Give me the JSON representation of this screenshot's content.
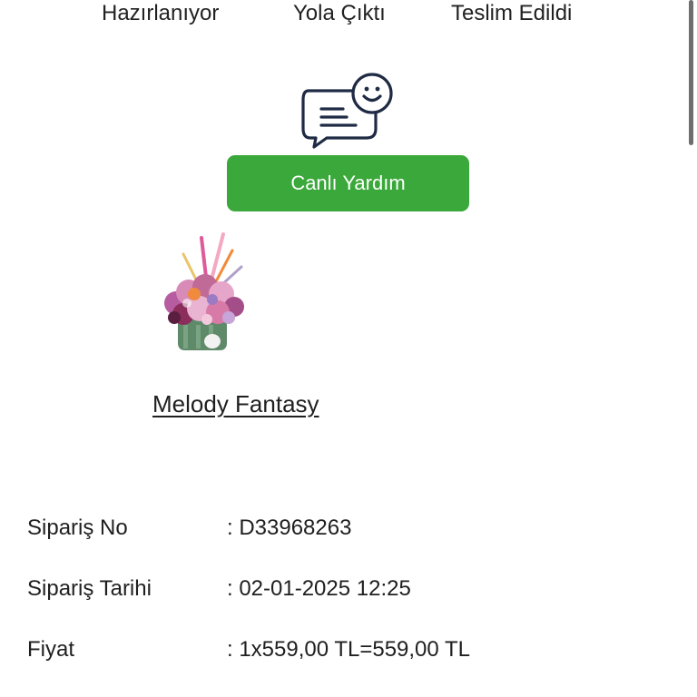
{
  "status_steps": [
    "Hazırlanıyor",
    "Yola Çıktı",
    "Teslim Edildi"
  ],
  "support": {
    "icon": "chat-support-icon",
    "button_label": "Canlı Yardım",
    "button_color": "#3aa83a"
  },
  "product": {
    "image_icon": "flower-bouquet-image",
    "name": "Melody Fantasy"
  },
  "order_details": [
    {
      "label": "Sipariş No",
      "value": ": D33968263"
    },
    {
      "label": "Sipariş Tarihi",
      "value": ": 02-01-2025 12:25"
    },
    {
      "label": "Fiyat",
      "value": ": 1x559,00 TL=559,00 TL"
    }
  ]
}
